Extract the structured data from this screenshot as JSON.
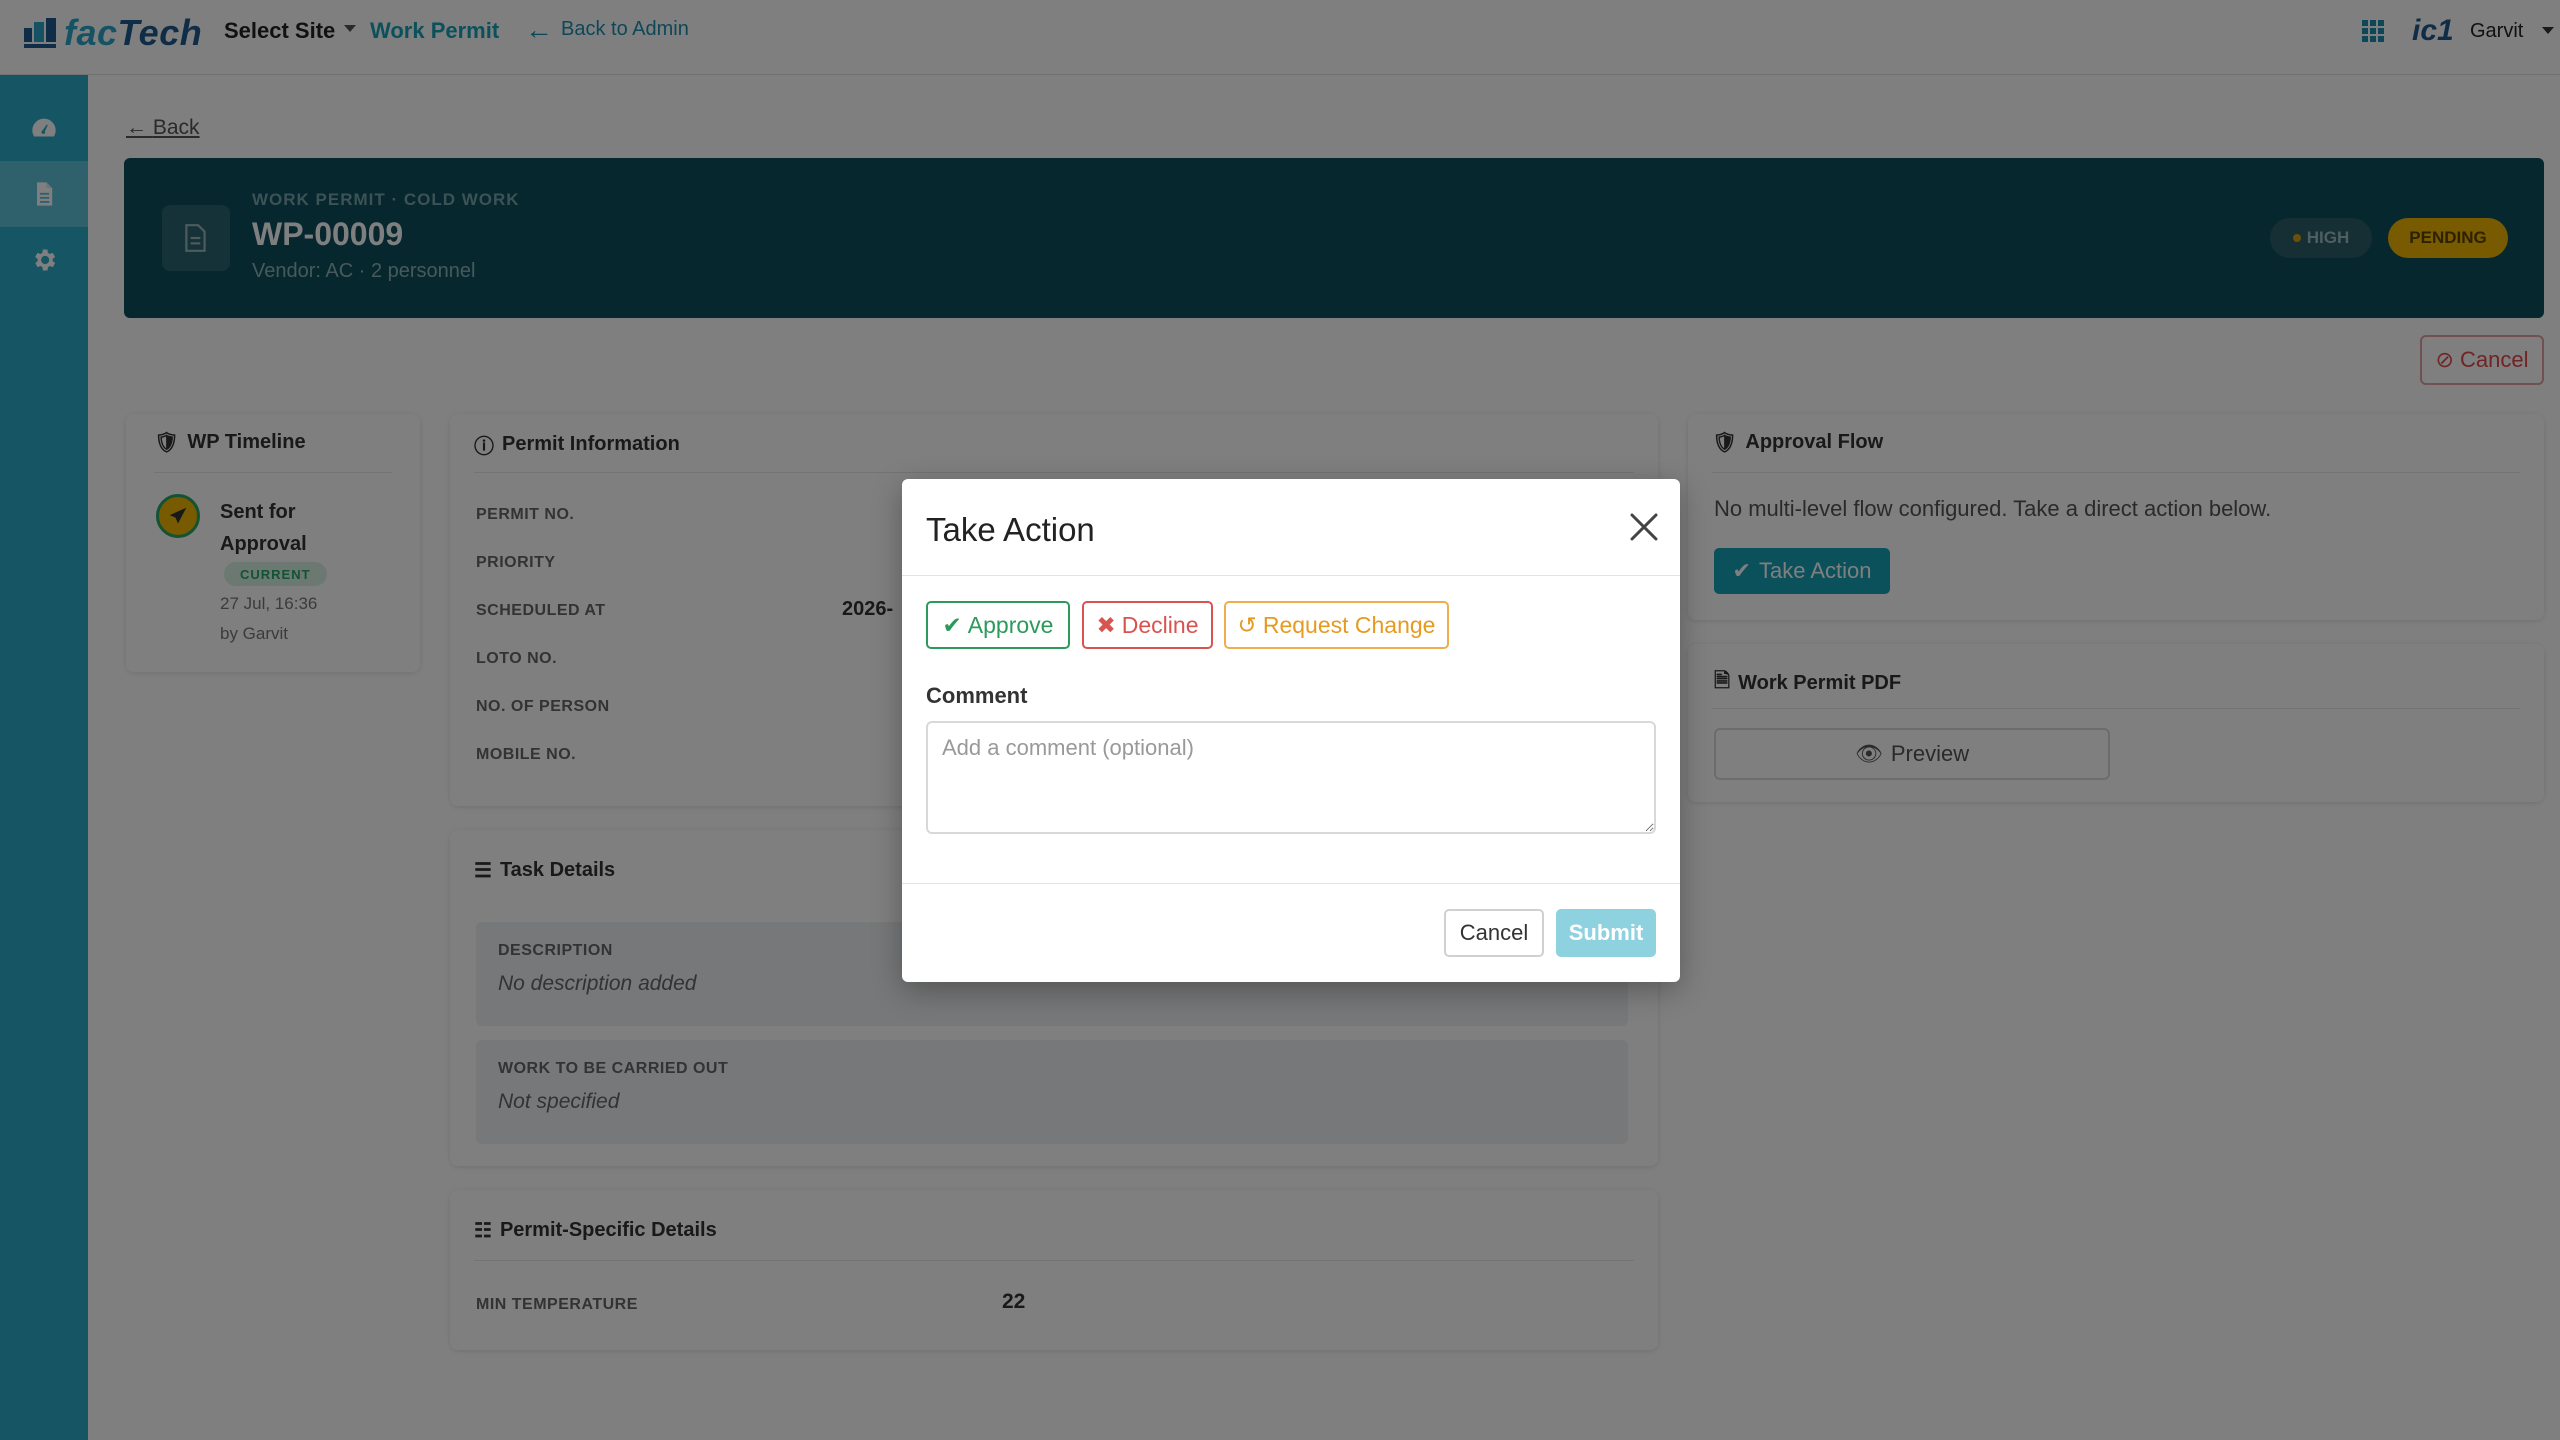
{
  "topbar": {
    "logo": {
      "part1": "fac",
      "part2": "Tech"
    },
    "select_site": "Select Site",
    "nav_work_permit": "Work Permit",
    "back_to_admin": "Back to Admin",
    "user_logo": "ic1",
    "user_name": "Garvit"
  },
  "sidebar": {
    "items": [
      {
        "icon": "dashboard-icon",
        "active": false
      },
      {
        "icon": "document-icon",
        "active": true
      },
      {
        "icon": "gear-icon",
        "active": false
      }
    ]
  },
  "page": {
    "back_label": "Back",
    "banner": {
      "subtitle": "WORK PERMIT · COLD WORK",
      "title": "WP-00009",
      "vendor": "Vendor: AC · 2 personnel",
      "priority_pill": "HIGH",
      "status_pill": "PENDING"
    },
    "cancel_label": "Cancel",
    "timeline": {
      "title": "WP Timeline",
      "entry": {
        "name": "Sent for Approval",
        "badge": "CURRENT",
        "date": "27 Jul, 16:36",
        "by": "by Garvit"
      }
    },
    "permit_info": {
      "title": "Permit Information",
      "rows": [
        {
          "label": "PERMIT NO.",
          "value": ""
        },
        {
          "label": "PRIORITY",
          "value": ""
        },
        {
          "label": "SCHEDULED AT",
          "value": "2026-"
        },
        {
          "label": "LOTO NO.",
          "value": ""
        },
        {
          "label": "NO. OF PERSON",
          "value": ""
        },
        {
          "label": "MOBILE NO.",
          "value": ""
        }
      ]
    },
    "task_details": {
      "title": "Task Details",
      "boxes": [
        {
          "label": "DESCRIPTION",
          "value": "No description added"
        },
        {
          "label": "WORK TO BE CARRIED OUT",
          "value": "Not specified"
        }
      ]
    },
    "permit_specific": {
      "title": "Permit-Specific Details",
      "label": "MIN TEMPERATURE",
      "value": "22"
    },
    "approval_flow": {
      "title": "Approval Flow",
      "text": "No multi-level flow configured. Take a direct action below.",
      "button": "Take Action"
    },
    "pdf": {
      "title": "Work Permit PDF",
      "button": "Preview"
    }
  },
  "modal": {
    "title": "Take Action",
    "approve": "Approve",
    "decline": "Decline",
    "request_change": "Request Change",
    "comment_label": "Comment",
    "comment_placeholder": "Add a comment (optional)",
    "comment_value": "",
    "cancel": "Cancel",
    "submit": "Submit"
  },
  "colors": {
    "accent": "#17a2b8",
    "sidebar": "#2aaac8",
    "banner": "#0c4f5c",
    "approve": "#2b9a5a",
    "decline": "#d9534f",
    "request_change": "#f0ad4e",
    "pending": "#f0b400"
  }
}
